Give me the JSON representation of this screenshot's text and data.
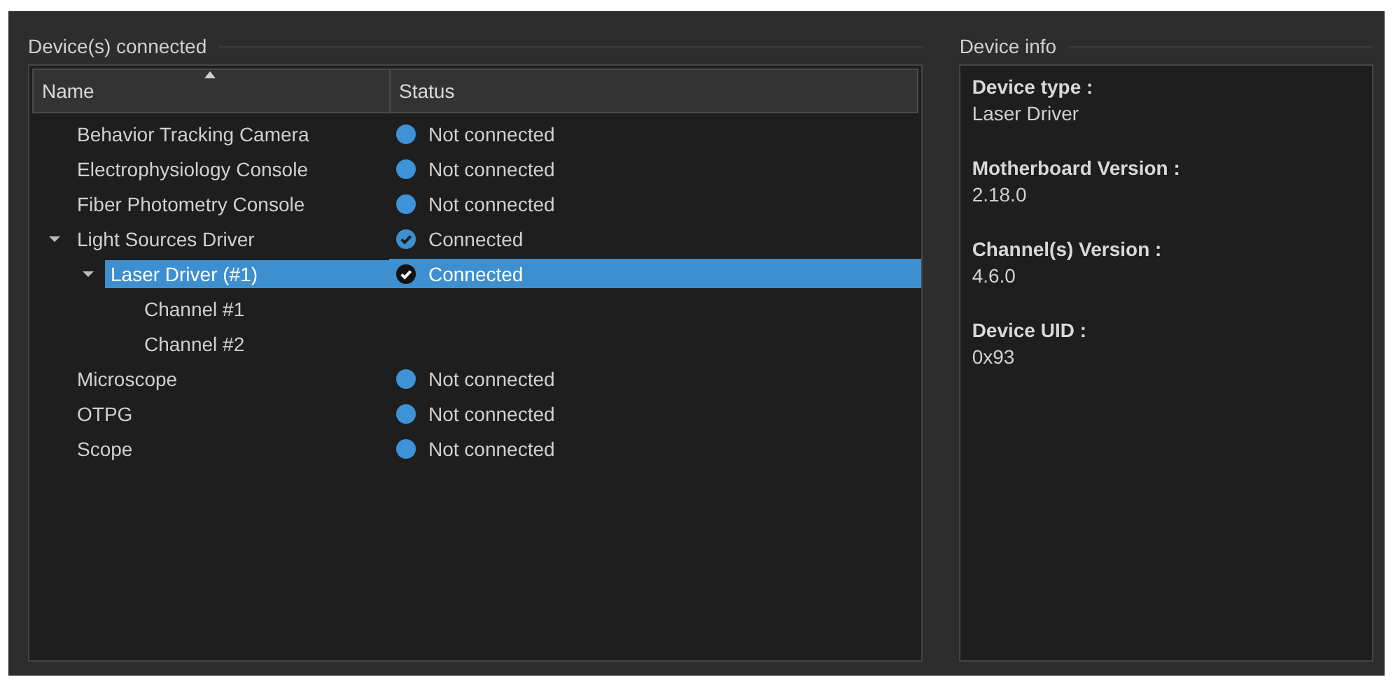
{
  "devices_group": {
    "title": "Device(s) connected",
    "columns": [
      {
        "label": "Name",
        "sorted": true
      },
      {
        "label": "Status",
        "sorted": false
      }
    ],
    "rows": [
      {
        "name": "Behavior Tracking Camera",
        "status": "Not connected",
        "connected": false,
        "selected": false
      },
      {
        "name": "Electrophysiology Console",
        "status": "Not connected",
        "connected": false,
        "selected": false
      },
      {
        "name": "Fiber Photometry Console",
        "status": "Not connected",
        "connected": false,
        "selected": false
      },
      {
        "name": "Light Sources Driver",
        "status": "Connected",
        "connected": true,
        "selected": false,
        "expanded": true,
        "children": [
          {
            "name": "Laser Driver (#1)",
            "status": "Connected",
            "connected": true,
            "selected": true,
            "expanded": true,
            "children": [
              {
                "name": "Channel #1",
                "selected": false
              },
              {
                "name": "Channel #2",
                "selected": false
              }
            ]
          }
        ]
      },
      {
        "name": "Microscope",
        "status": "Not connected",
        "connected": false,
        "selected": false
      },
      {
        "name": "OTPG",
        "status": "Not connected",
        "connected": false,
        "selected": false
      },
      {
        "name": "Scope",
        "status": "Not connected",
        "connected": false,
        "selected": false
      }
    ]
  },
  "info_group": {
    "title": "Device info",
    "fields": [
      {
        "label": "Device type :",
        "value": "Laser Driver"
      },
      {
        "label": "Motherboard Version :",
        "value": "2.18.0"
      },
      {
        "label": "Channel(s) Version :",
        "value": "4.6.0"
      },
      {
        "label": "Device UID :",
        "value": "0x93"
      }
    ]
  }
}
